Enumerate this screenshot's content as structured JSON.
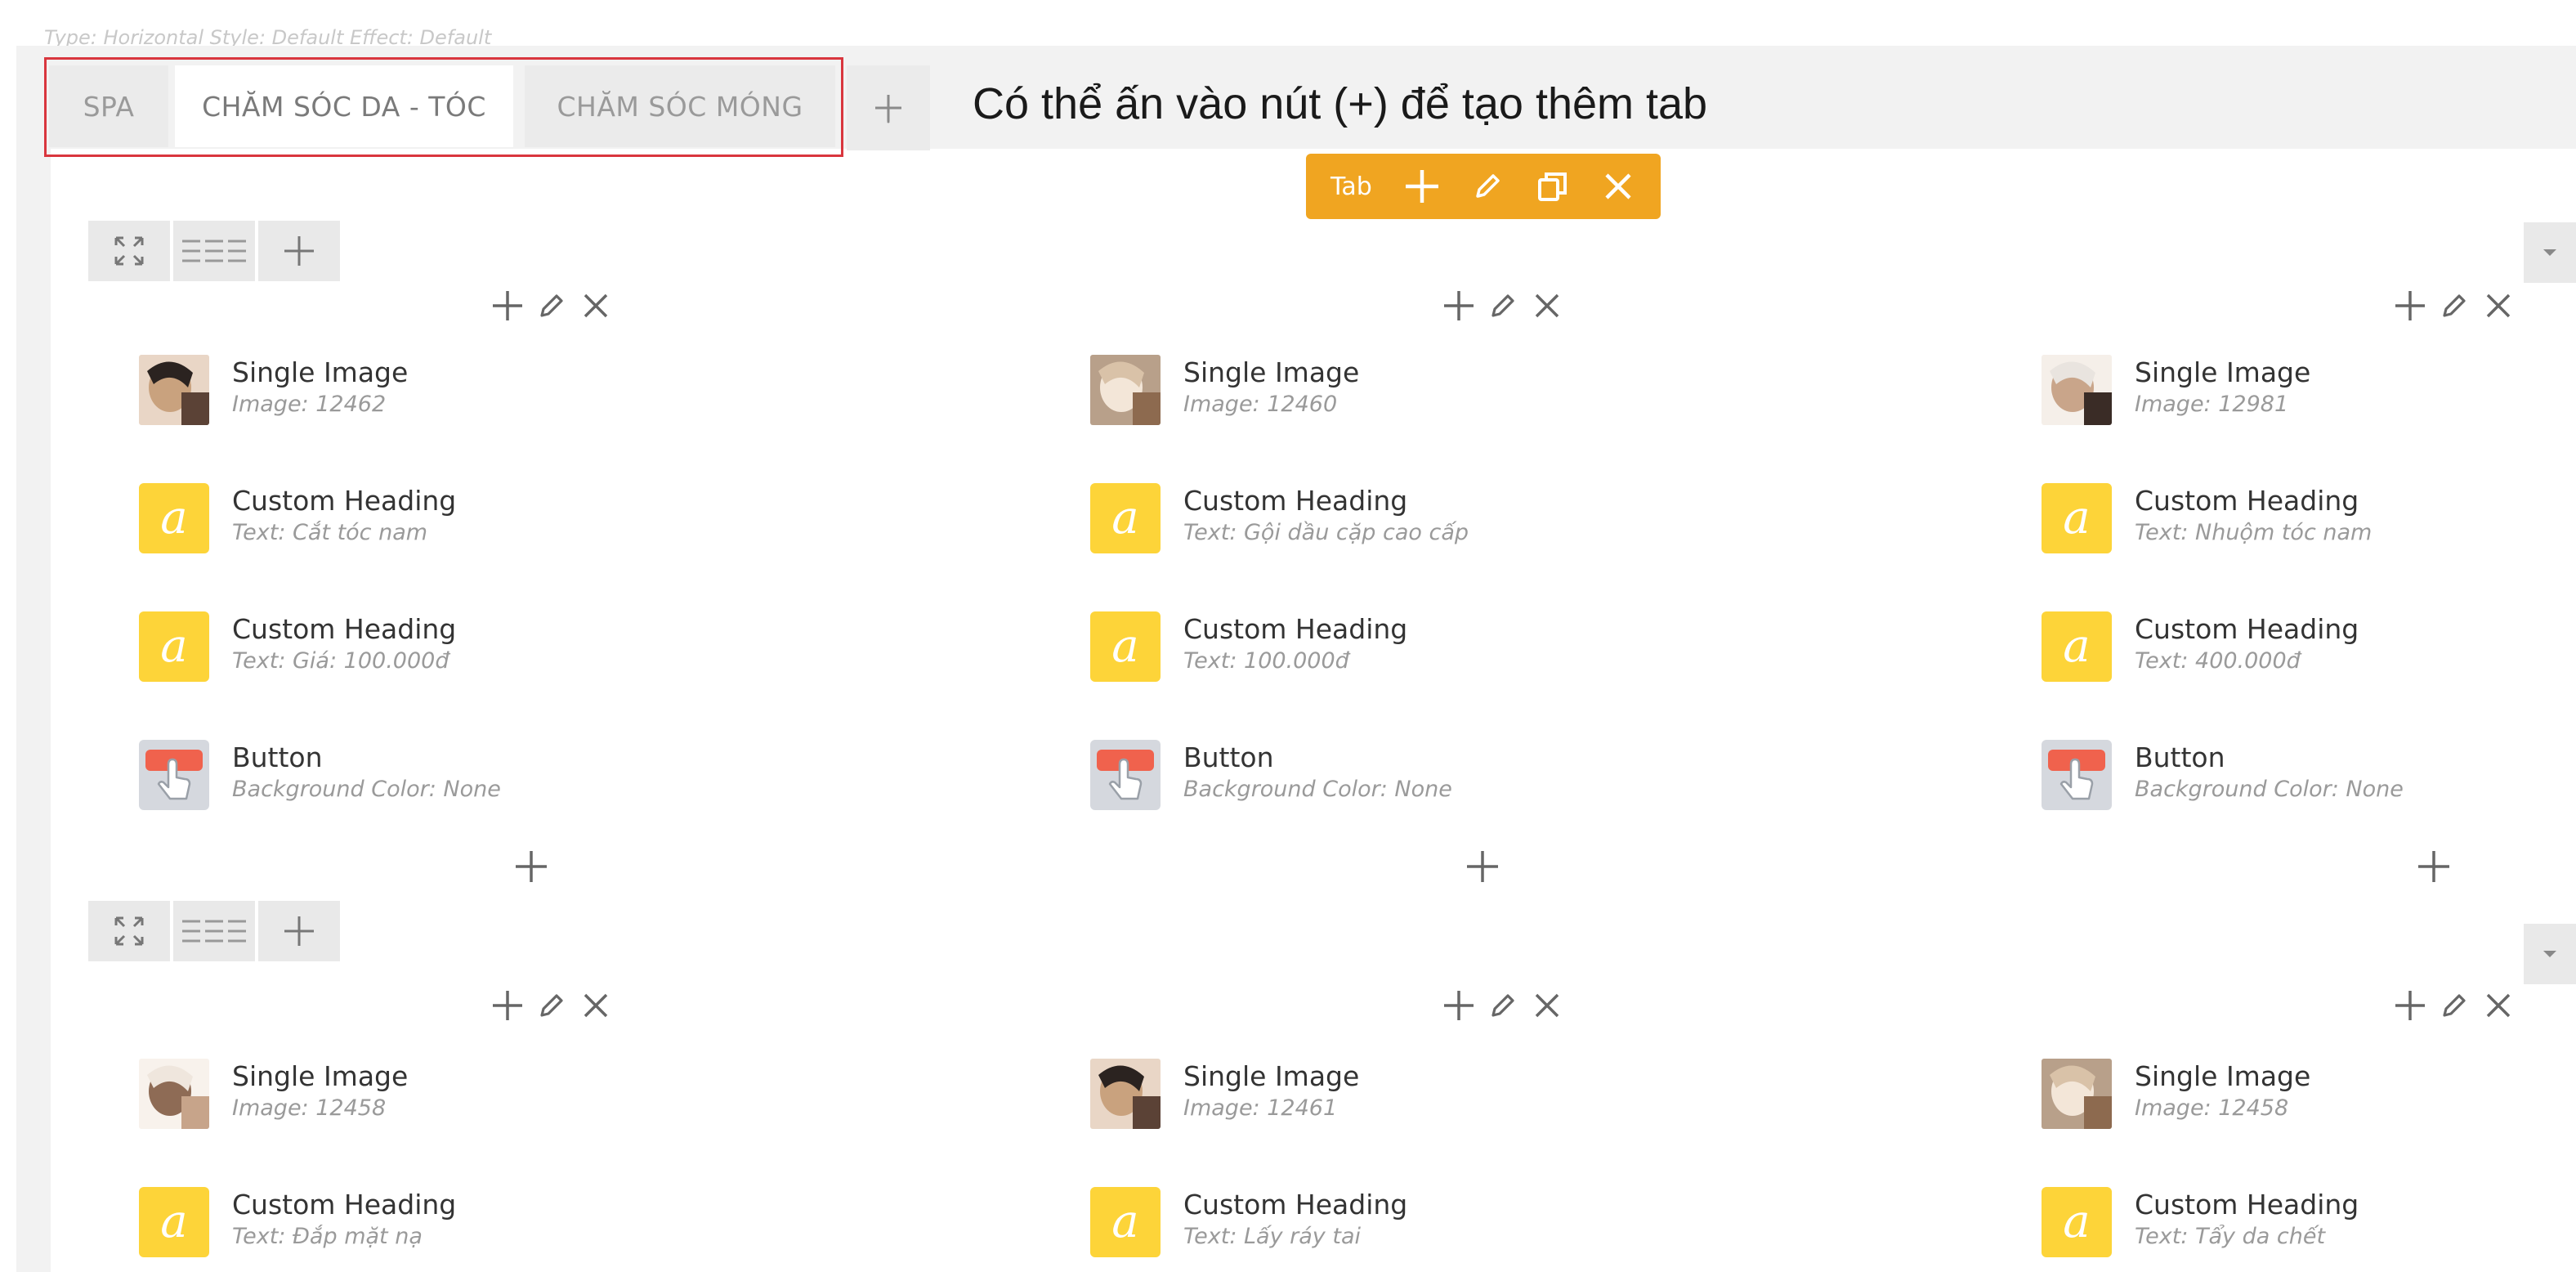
{
  "top_cut_text": "Type: Horizontal  Style: Default  Effect: Default",
  "tabs": [
    {
      "label": "SPA"
    },
    {
      "label": "CHĂM SÓC DA - TÓC"
    },
    {
      "label": "CHĂM SÓC MÓNG"
    }
  ],
  "add_tab_label": "+",
  "hint": "Có thể ấn vào nút (+) để tạo thêm tab",
  "tab_toolbar": {
    "label": "Tab"
  },
  "rows": [
    {
      "columns": [
        {
          "elements": [
            {
              "type": "image",
              "title": "Single Image",
              "sub": "Image: 12462"
            },
            {
              "type": "heading",
              "title": "Custom Heading",
              "sub": "Text: Cắt tóc nam"
            },
            {
              "type": "heading",
              "title": "Custom Heading",
              "sub": "Text: Giá: 100.000đ"
            },
            {
              "type": "button",
              "title": "Button",
              "sub": "Background Color: None"
            }
          ]
        },
        {
          "elements": [
            {
              "type": "image",
              "title": "Single Image",
              "sub": "Image: 12460"
            },
            {
              "type": "heading",
              "title": "Custom Heading",
              "sub": "Text: Gội dầu cặp cao cấp"
            },
            {
              "type": "heading",
              "title": "Custom Heading",
              "sub": "Text: 100.000đ"
            },
            {
              "type": "button",
              "title": "Button",
              "sub": "Background Color: None"
            }
          ]
        },
        {
          "elements": [
            {
              "type": "image",
              "title": "Single Image",
              "sub": "Image: 12981"
            },
            {
              "type": "heading",
              "title": "Custom Heading",
              "sub": "Text: Nhuộm tóc nam"
            },
            {
              "type": "heading",
              "title": "Custom Heading",
              "sub": "Text: 400.000đ"
            },
            {
              "type": "button",
              "title": "Button",
              "sub": "Background Color: None"
            }
          ]
        }
      ]
    },
    {
      "columns": [
        {
          "elements": [
            {
              "type": "image",
              "title": "Single Image",
              "sub": "Image: 12458"
            },
            {
              "type": "heading",
              "title": "Custom Heading",
              "sub": "Text: Đắp mặt nạ"
            }
          ]
        },
        {
          "elements": [
            {
              "type": "image",
              "title": "Single Image",
              "sub": "Image: 12461"
            },
            {
              "type": "heading",
              "title": "Custom Heading",
              "sub": "Text: Lấy ráy tai"
            }
          ]
        },
        {
          "elements": [
            {
              "type": "image",
              "title": "Single Image",
              "sub": "Image: 12458"
            },
            {
              "type": "heading",
              "title": "Custom Heading",
              "sub": "Text: Tẩy da chết"
            }
          ]
        }
      ]
    }
  ],
  "heading_icon_glyph": "a",
  "colors": {
    "accent": "#f0a521",
    "heading_icon": "#fdd439",
    "highlight": "#d9363e",
    "button_icon_red": "#f0624d"
  }
}
